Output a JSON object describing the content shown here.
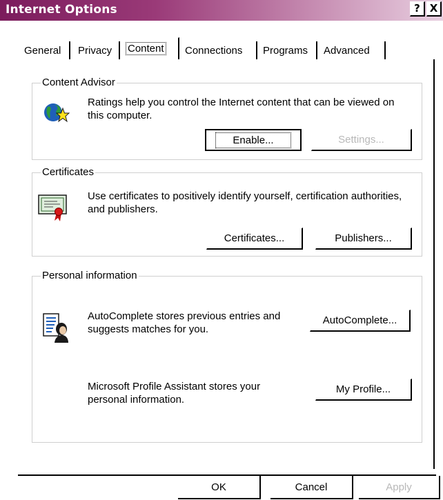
{
  "window": {
    "title": "Internet Options",
    "help_glyph": "?",
    "close_glyph": "X"
  },
  "tabs": [
    {
      "label": "General"
    },
    {
      "label": "Privacy"
    },
    {
      "label": "Content",
      "active": true
    },
    {
      "label": "Connections"
    },
    {
      "label": "Programs"
    },
    {
      "label": "Advanced"
    }
  ],
  "content_advisor": {
    "heading": "Content Advisor",
    "description": "Ratings help you control the Internet content that can be viewed on this computer.",
    "icon": "globe-star-icon",
    "enable_label": "Enable...",
    "settings_label": "Settings..."
  },
  "certificates": {
    "heading": "Certificates",
    "description": "Use certificates to positively identify yourself, certification authorities, and publishers.",
    "icon": "certificate-icon",
    "certificates_label": "Certificates...",
    "publishers_label": "Publishers..."
  },
  "personal_information": {
    "heading": "Personal information",
    "autocomplete_text": "AutoComplete stores previous entries and suggests matches for you.",
    "autocomplete_icon": "document-person-icon",
    "autocomplete_label": "AutoComplete...",
    "profile_text": "Microsoft Profile Assistant stores your personal information.",
    "profile_label": "My Profile..."
  },
  "footer": {
    "ok_label": "OK",
    "cancel_label": "Cancel",
    "apply_label": "Apply"
  },
  "colors": {
    "titlebar_start": "#7b1c5c",
    "titlebar_end": "#e8cfe0",
    "disabled_text": "#b8b8b8"
  }
}
